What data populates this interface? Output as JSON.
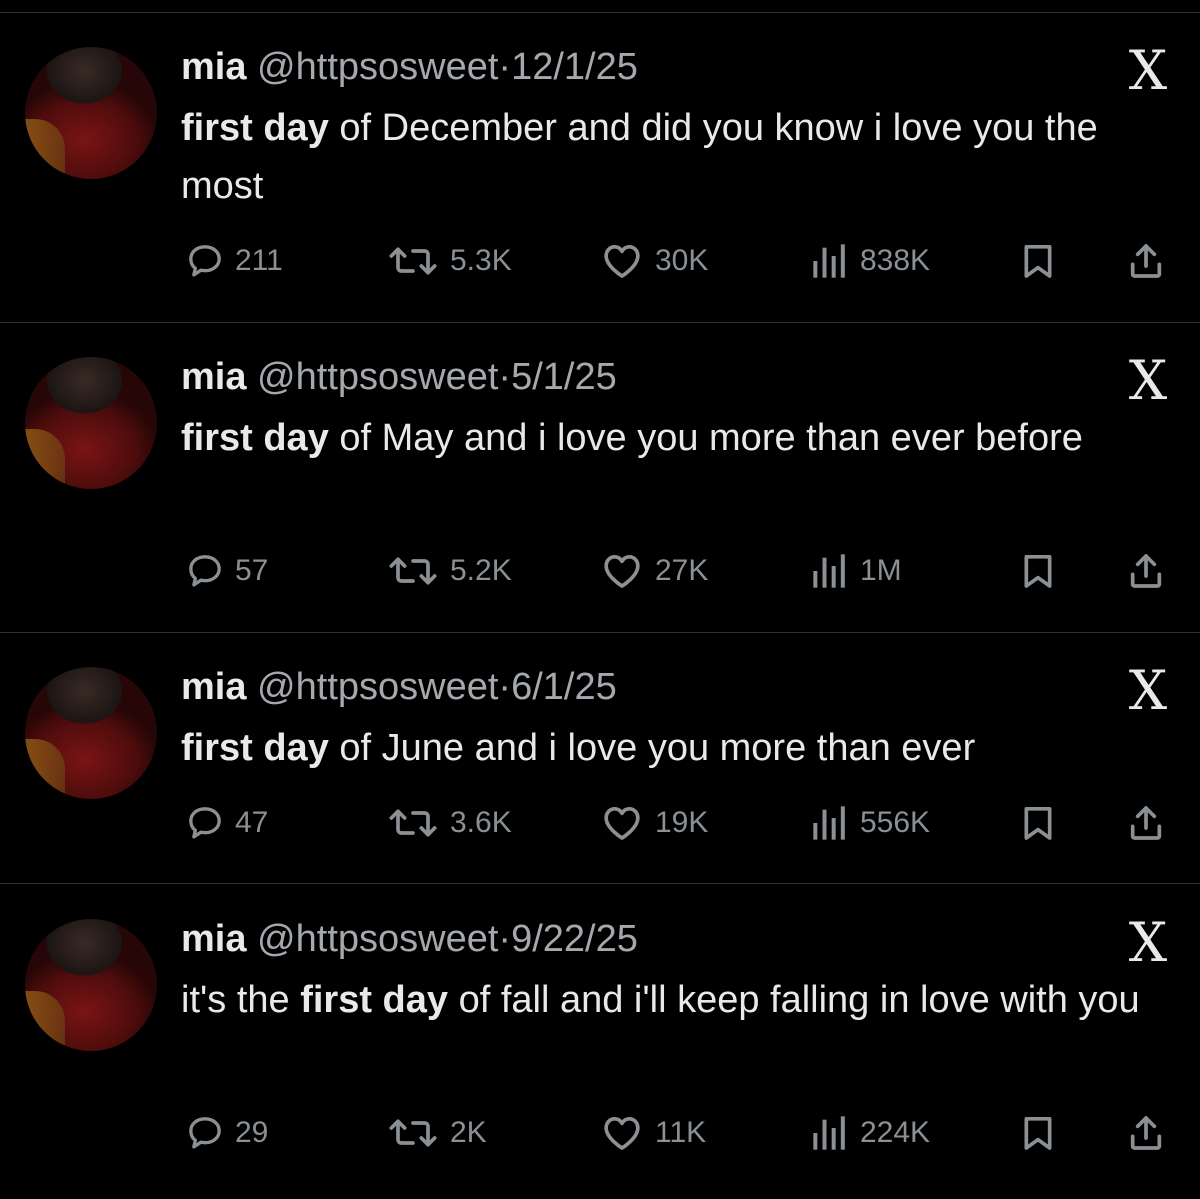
{
  "tweets": [
    {
      "name": "mia",
      "handle": "@httpsosweet",
      "separator": "·",
      "date": "12/1/25",
      "text_prefix": "",
      "text_bold": "first day",
      "text_rest": " of December and did you know i love you the most",
      "replies": "211",
      "reposts": "5.3K",
      "likes": "30K",
      "views": "838K"
    },
    {
      "name": "mia",
      "handle": "@httpsosweet",
      "separator": "·",
      "date": "5/1/25",
      "text_prefix": "",
      "text_bold": "first day",
      "text_rest": " of May and i love you more than ever before",
      "replies": "57",
      "reposts": "5.2K",
      "likes": "27K",
      "views": "1M"
    },
    {
      "name": "mia",
      "handle": "@httpsosweet",
      "separator": "·",
      "date": "6/1/25",
      "text_prefix": "",
      "text_bold": "first day",
      "text_rest": " of June and i love you more than ever",
      "replies": "47",
      "reposts": "3.6K",
      "likes": "19K",
      "views": "556K"
    },
    {
      "name": "mia",
      "handle": "@httpsosweet",
      "separator": "·",
      "date": "9/22/25",
      "text_prefix": "it's the ",
      "text_bold": "first day",
      "text_rest": " of fall and i'll keep falling in love with you",
      "replies": "29",
      "reposts": "2K",
      "likes": "11K",
      "views": "224K"
    }
  ],
  "icons": {
    "reply": "reply-icon",
    "repost": "repost-icon",
    "like": "heart-icon",
    "views": "views-icon",
    "bookmark": "bookmark-icon",
    "share": "share-icon",
    "brand": "x-logo-icon"
  },
  "colors": {
    "background": "#000000",
    "text": "#e7e9ea",
    "secondary": "#a5a9ad",
    "divider": "#2f3336"
  },
  "brand_glyph": "X"
}
